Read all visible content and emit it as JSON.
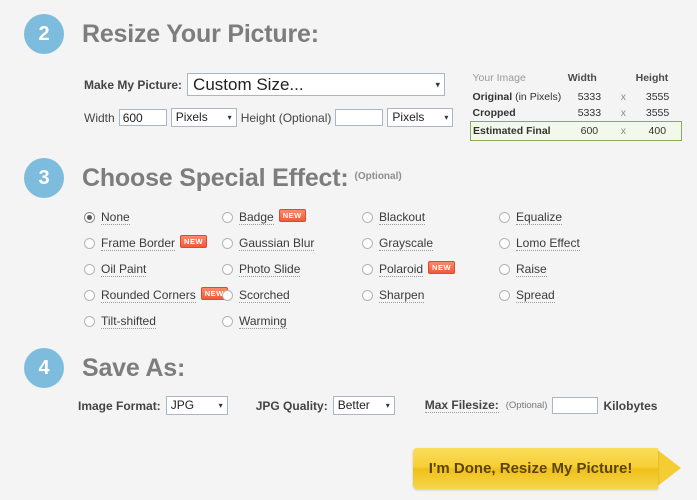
{
  "steps": {
    "two": {
      "number": "2",
      "title": "Resize Your Picture:"
    },
    "three": {
      "number": "3",
      "title": "Choose Special Effect:",
      "optional": "(Optional)"
    },
    "four": {
      "number": "4",
      "title": "Save As:"
    }
  },
  "resize": {
    "preset_label": "Make My Picture:",
    "preset_value": "Custom Size...",
    "width_label": "Width",
    "width_value": "600",
    "width_unit": "Pixels",
    "height_label": "Height (Optional)",
    "height_value": "",
    "height_unit": "Pixels"
  },
  "info_table": {
    "headers": [
      "Your Image",
      "Width",
      "",
      "Height"
    ],
    "rows": [
      {
        "name": "Original",
        "name_suffix": " (in Pixels)",
        "width": "5333",
        "x": "x",
        "height": "3555",
        "highlight": false
      },
      {
        "name": "Cropped",
        "name_suffix": "",
        "width": "5333",
        "x": "x",
        "height": "3555",
        "highlight": false
      },
      {
        "name": "Estimated Final",
        "name_suffix": "",
        "width": "600",
        "x": "x",
        "height": "400",
        "highlight": true
      }
    ]
  },
  "effects": {
    "selected": "None",
    "items": [
      {
        "label": "None",
        "new": false,
        "col": 0,
        "row": 0,
        "checked": true
      },
      {
        "label": "Frame Border",
        "new": true,
        "col": 0,
        "row": 1,
        "checked": false
      },
      {
        "label": "Oil Paint",
        "new": false,
        "col": 0,
        "row": 2,
        "checked": false
      },
      {
        "label": "Rounded Corners",
        "new": true,
        "col": 0,
        "row": 3,
        "checked": false
      },
      {
        "label": "Tilt-shifted",
        "new": false,
        "col": 0,
        "row": 4,
        "checked": false
      },
      {
        "label": "Badge",
        "new": true,
        "col": 1,
        "row": 0,
        "checked": false
      },
      {
        "label": "Gaussian Blur",
        "new": false,
        "col": 1,
        "row": 1,
        "checked": false
      },
      {
        "label": "Photo Slide",
        "new": false,
        "col": 1,
        "row": 2,
        "checked": false
      },
      {
        "label": "Scorched",
        "new": false,
        "col": 1,
        "row": 3,
        "checked": false
      },
      {
        "label": "Warming",
        "new": false,
        "col": 1,
        "row": 4,
        "checked": false
      },
      {
        "label": "Blackout",
        "new": false,
        "col": 2,
        "row": 0,
        "checked": false
      },
      {
        "label": "Grayscale",
        "new": false,
        "col": 2,
        "row": 1,
        "checked": false
      },
      {
        "label": "Polaroid",
        "new": true,
        "col": 2,
        "row": 2,
        "checked": false
      },
      {
        "label": "Sharpen",
        "new": false,
        "col": 2,
        "row": 3,
        "checked": false
      },
      {
        "label": "Equalize",
        "new": false,
        "col": 3,
        "row": 0,
        "checked": false
      },
      {
        "label": "Lomo Effect",
        "new": false,
        "col": 3,
        "row": 1,
        "checked": false
      },
      {
        "label": "Raise",
        "new": false,
        "col": 3,
        "row": 2,
        "checked": false
      },
      {
        "label": "Spread",
        "new": false,
        "col": 3,
        "row": 3,
        "checked": false
      }
    ],
    "new_badge_text": "NEW"
  },
  "save_as": {
    "format_label": "Image Format:",
    "format_value": "JPG",
    "quality_label": "JPG Quality:",
    "quality_value": "Better",
    "maxfs_label": "Max Filesize:",
    "maxfs_optional": "(Optional)",
    "maxfs_value": "",
    "maxfs_unit": "Kilobytes"
  },
  "done_button": {
    "label": "I'm Done, Resize My Picture!"
  },
  "colors": {
    "page_bg": "#f4f4f4",
    "step_circle": "#7dbcdd",
    "heading": "#7d7d7d",
    "badge_new": "#f4593a",
    "estimate_border": "#8aab5e",
    "estimate_bg": "#f2f8ea",
    "button_yellow": "#f7cf36"
  },
  "icons": {
    "dropdown": "▾"
  }
}
